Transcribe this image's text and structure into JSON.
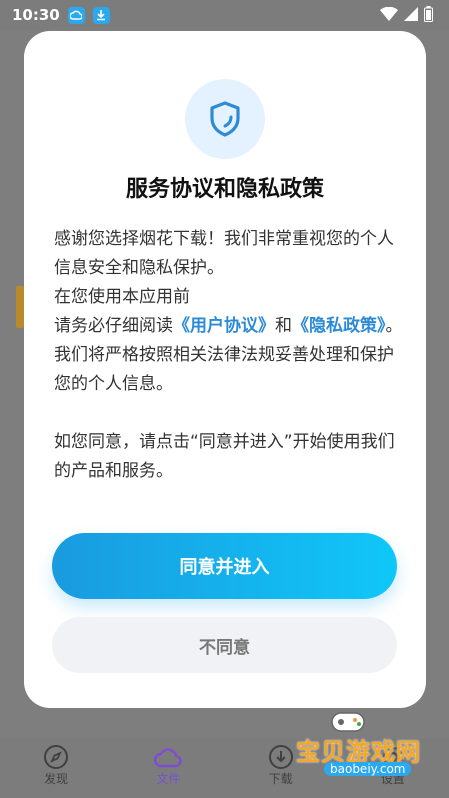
{
  "status_bar": {
    "time": "10:30"
  },
  "dialog": {
    "title": "服务协议和隐私政策",
    "para1": "感谢您选择烟花下载！我们非常重视您的个人信息安全和隐私保护。",
    "para2": "在您使用本应用前",
    "para3_prefix": "请务必仔细阅读",
    "user_agreement_link": "《用户协议》",
    "and": "和",
    "privacy_policy_link": "《隐私政策》",
    "para3_suffix": "。我们将严格按照相关法律法规妥善处理和保护您的个人信息。",
    "para4": "如您同意，请点击“同意并进入”开始使用我们的产品和服务。",
    "agree_label": "同意并进入",
    "disagree_label": "不同意"
  },
  "bottom_nav": {
    "items": [
      {
        "label": "发现",
        "icon": "compass-icon"
      },
      {
        "label": "文件",
        "icon": "cloud-icon",
        "active": true
      },
      {
        "label": "下载",
        "icon": "download-icon"
      },
      {
        "label": "设置",
        "icon": "gear-icon"
      }
    ]
  },
  "watermark": {
    "title": "宝贝游戏网",
    "url": "baobeiy.com"
  },
  "colors": {
    "accent": "#1a9ae0",
    "link": "#2d8bd6",
    "nav_active": "#7b4fd0"
  }
}
